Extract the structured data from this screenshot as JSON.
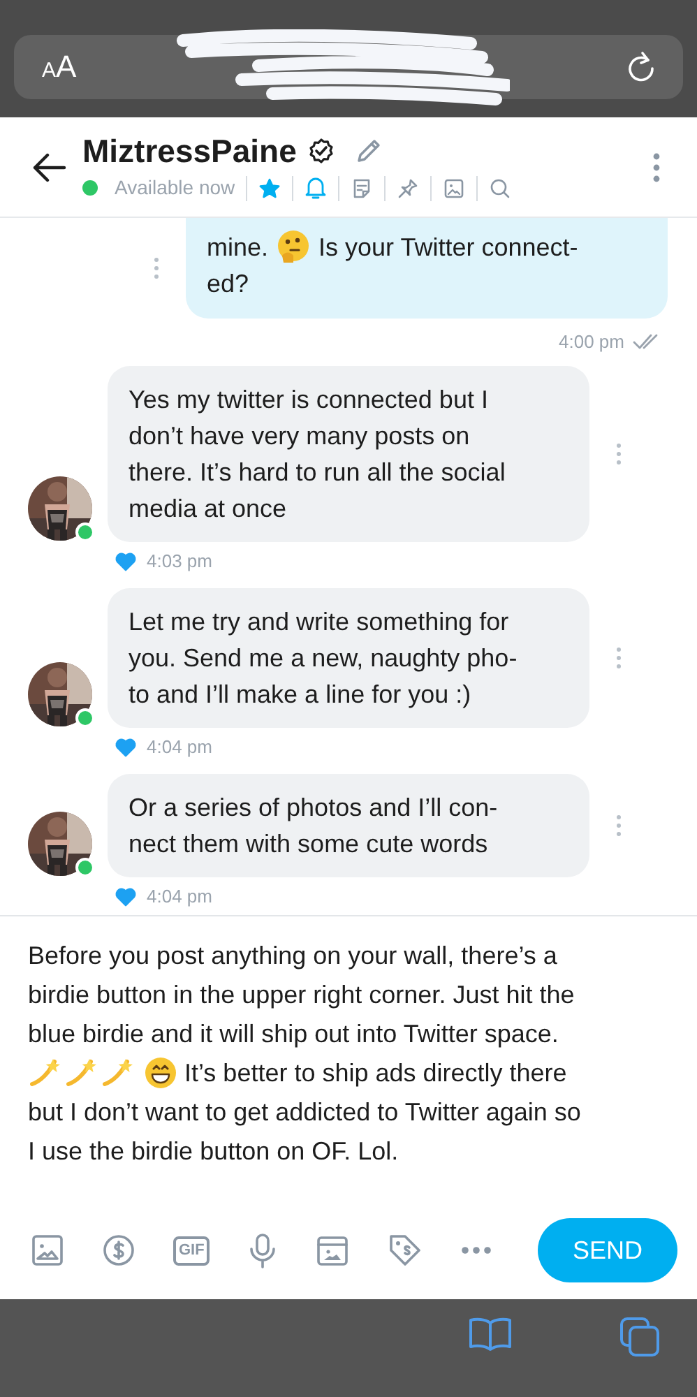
{
  "browser": {
    "text_size_button": "AA"
  },
  "header": {
    "name": "MiztressPaine",
    "status": "Available now",
    "online": true,
    "favorited": true,
    "notifications_on": true
  },
  "messages": [
    {
      "kind": "sent",
      "lines": [
        [
          {
            "kind": "text",
            "text": "mine."
          },
          {
            "kind": "thinking-emoji"
          },
          {
            "kind": "text",
            "text": "Is your Twitter connect-"
          }
        ],
        [
          {
            "kind": "text",
            "text": "ed?"
          }
        ]
      ],
      "time": "4:00 pm",
      "read": true
    },
    {
      "kind": "received",
      "lines": [
        [
          {
            "kind": "text",
            "text": "Yes my twitter is connected but I\ndon’t have very many posts on\nthere. It’s hard to run all the social\nmedia at once"
          }
        ]
      ],
      "time": "4:03 pm",
      "liked": true,
      "online": true
    },
    {
      "kind": "received",
      "lines": [
        [
          {
            "kind": "text",
            "text": "Let me try and write something for\nyou. Send me a new, naughty pho-\nto and I’ll make a line for you :)"
          }
        ]
      ],
      "time": "4:04 pm",
      "liked": true,
      "online": true
    },
    {
      "kind": "received",
      "lines": [
        [
          {
            "kind": "text",
            "text": "Or a series of photos and I’ll con-\nnect them with some cute words"
          }
        ]
      ],
      "time": "4:04 pm",
      "liked": true,
      "online": true
    }
  ],
  "composer": {
    "lines": [
      [
        {
          "kind": "text",
          "text": "Before you post anything on your wall, there’s a\nbirdie button in the upper right corner. Just hit the\nblue birdie and it will ship out into Twitter space."
        }
      ],
      [
        {
          "kind": "dizzy-emoji"
        },
        {
          "kind": "dizzy-emoji"
        },
        {
          "kind": "dizzy-emoji"
        },
        {
          "kind": "grinning-emoji"
        },
        {
          "kind": "text",
          "text": "It’s better to ship ads directly there"
        }
      ],
      [
        {
          "kind": "text",
          "text": "but I don’t want to get addicted to Twitter again so\nI use the birdie button on OF. Lol."
        }
      ]
    ]
  },
  "toolbar": {
    "gif_label": "GIF"
  },
  "send_button": "SEND"
}
